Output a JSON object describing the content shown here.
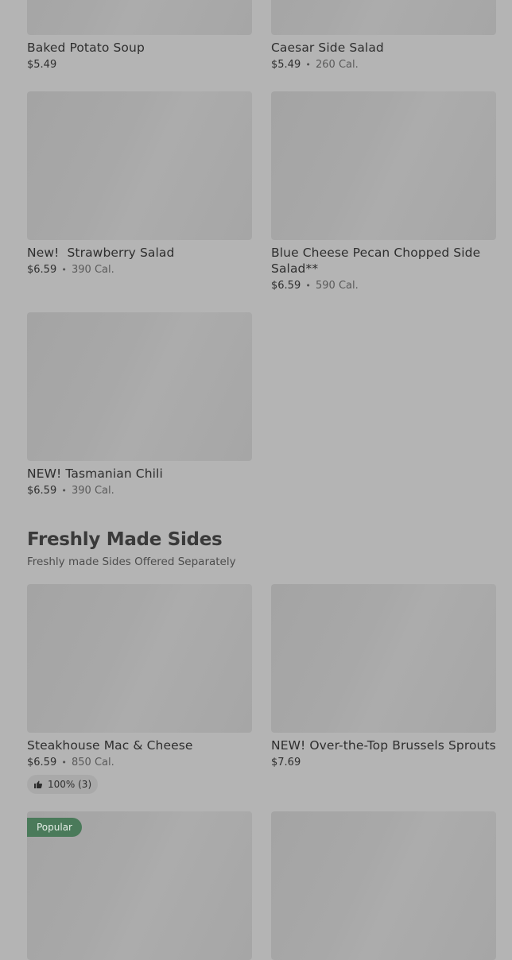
{
  "colors": {
    "background": "#b4b4b4",
    "thumbnail": "#a6a6a6",
    "popular_badge": "#4a7a5a"
  },
  "items_top": [
    {
      "name": "Baked Potato Soup",
      "price": "$5.49",
      "calories": ""
    },
    {
      "name": "Caesar Side Salad",
      "price": "$5.49",
      "calories": "260 Cal."
    },
    {
      "name": "New!  Strawberry Salad",
      "price": "$6.59",
      "calories": "390 Cal."
    },
    {
      "name": "Blue Cheese Pecan Chopped Side Salad**",
      "price": "$6.59",
      "calories": "590 Cal."
    },
    {
      "name": "NEW! Tasmanian Chili",
      "price": "$6.59",
      "calories": "390 Cal."
    }
  ],
  "separator": "•",
  "sides_section": {
    "title": "Freshly Made Sides",
    "subtitle": "Freshly made Sides Offered Separately",
    "items": [
      {
        "name": "Steakhouse Mac & Cheese",
        "price": "$6.59",
        "calories": "850 Cal.",
        "rating": "100% (3)",
        "rating_icon": "thumbs-up-icon"
      },
      {
        "name": "NEW! Over-the-Top Brussels Sprouts",
        "price": "$7.69",
        "calories": ""
      }
    ],
    "popular_badge": "Popular"
  }
}
